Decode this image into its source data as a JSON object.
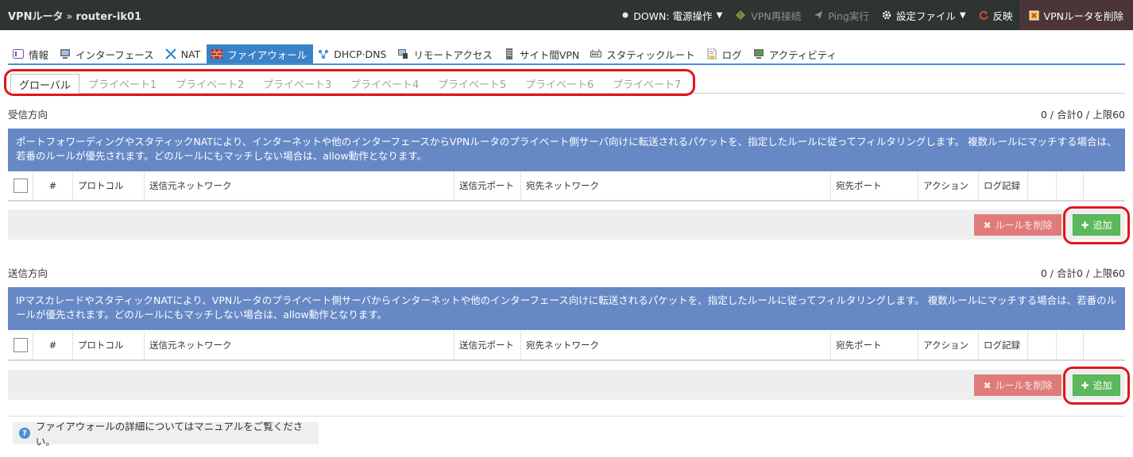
{
  "header": {
    "app_name": "VPNルータ",
    "separator": "»",
    "router_name": "router-ik01",
    "status_label": "DOWN: 電源操作",
    "reconnect_label": "VPN再接続",
    "ping_label": "Ping実行",
    "config_label": "設定ファイル",
    "apply_label": "反映",
    "delete_label": "VPNルータを削除"
  },
  "menu_tabs": [
    {
      "label": "情報",
      "icon": "info-icon"
    },
    {
      "label": "インターフェース",
      "icon": "monitor-icon"
    },
    {
      "label": "NAT",
      "icon": "nat-icon"
    },
    {
      "label": "ファイアウォール",
      "icon": "firewall-icon",
      "active": true
    },
    {
      "label": "DHCP·DNS",
      "icon": "dhcp-icon"
    },
    {
      "label": "リモートアクセス",
      "icon": "remote-icon"
    },
    {
      "label": "サイト間VPN",
      "icon": "site-vpn-icon"
    },
    {
      "label": "スタティックルート",
      "icon": "route-icon"
    },
    {
      "label": "ログ",
      "icon": "log-icon"
    },
    {
      "label": "アクティビティ",
      "icon": "activity-icon"
    }
  ],
  "sub_tabs": [
    "グローバル",
    "プライベート1",
    "プライベート2",
    "プライベート3",
    "プライベート4",
    "プライベート5",
    "プライベート6",
    "プライベート7"
  ],
  "inbound": {
    "title": "受信方向",
    "count": "0 / 合計0 / 上限60",
    "description": "ポートフォワーディングやスタティックNATにより、インターネットや他のインターフェースからVPNルータのプライベート側サーバ向けに転送されるパケットを、指定したルールに従ってフィルタリングします。 複数ルールにマッチする場合は、若番のルールが優先されます。どのルールにもマッチしない場合は、allow動作となります。",
    "delete_label": "ルールを削除",
    "add_label": "追加"
  },
  "outbound": {
    "title": "送信方向",
    "count": "0 / 合計0 / 上限60",
    "description": "IPマスカレードやスタティックNATにより、VPNルータのプライベート側サーバからインターネットや他のインターフェース向けに転送されるパケットを、指定したルールに従ってフィルタリングします。 複数ルールにマッチする場合は、若番のルールが優先されます。どのルールにもマッチしない場合は、allow動作となります。",
    "delete_label": "ルールを削除",
    "add_label": "追加"
  },
  "columns": [
    "#",
    "プロトコル",
    "送信元ネットワーク",
    "送信元ポート",
    "宛先ネットワーク",
    "宛先ポート",
    "アクション",
    "ログ記録"
  ],
  "help_text": "ファイアウォールの詳細についてはマニュアルをご覧ください。",
  "colors": {
    "header_bg": "#2e3432",
    "active_tab": "#3a82c8",
    "description_bg": "#6688c5",
    "add_button": "#5cb85c",
    "delete_button": "#e07b7b",
    "highlight": "#e0151b"
  }
}
